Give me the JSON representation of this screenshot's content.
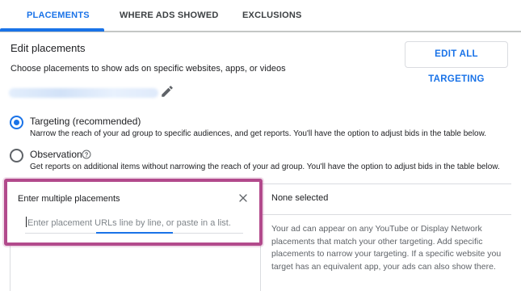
{
  "tabs": [
    {
      "label": "PLACEMENTS",
      "active": true
    },
    {
      "label": "WHERE ADS SHOWED",
      "active": false
    },
    {
      "label": "EXCLUSIONS",
      "active": false
    }
  ],
  "header": {
    "title": "Edit placements",
    "subtitle": "Choose placements to show ads on specific websites, apps, or videos",
    "edit_all_button": "EDIT ALL TARGETING"
  },
  "options": {
    "targeting": {
      "label": "Targeting (recommended)",
      "description": "Narrow the reach of your ad group to specific audiences, and get reports. You'll have the option to adjust bids in the table below.",
      "selected": true
    },
    "observation": {
      "label": "Observation",
      "description": "Get reports on additional items without narrowing the reach of your ad group. You'll have the option to adjust bids in the table below.",
      "selected": false
    }
  },
  "multiple_placements": {
    "title": "Enter multiple placements",
    "placeholder": "Enter placement URLs line by line, or paste in a list."
  },
  "selection_panel": {
    "status": "None selected",
    "info": "Your ad can appear on any YouTube or Display Network placements that match your other targeting. Add specific placements to narrow your targeting. If a specific website you target has an equivalent app, your ads can also show there."
  },
  "colors": {
    "accent": "#1a73e8",
    "highlight": "#b24a8c",
    "border": "#dadce0"
  },
  "icons": [
    "pencil-icon",
    "help-icon",
    "close-icon"
  ]
}
